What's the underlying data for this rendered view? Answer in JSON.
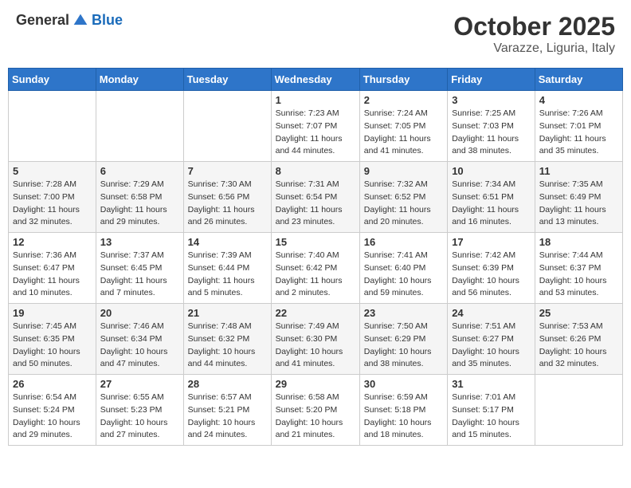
{
  "header": {
    "logo_general": "General",
    "logo_blue": "Blue",
    "month": "October 2025",
    "location": "Varazze, Liguria, Italy"
  },
  "weekdays": [
    "Sunday",
    "Monday",
    "Tuesday",
    "Wednesday",
    "Thursday",
    "Friday",
    "Saturday"
  ],
  "weeks": [
    [
      {
        "day": "",
        "info": ""
      },
      {
        "day": "",
        "info": ""
      },
      {
        "day": "",
        "info": ""
      },
      {
        "day": "1",
        "info": "Sunrise: 7:23 AM\nSunset: 7:07 PM\nDaylight: 11 hours and 44 minutes."
      },
      {
        "day": "2",
        "info": "Sunrise: 7:24 AM\nSunset: 7:05 PM\nDaylight: 11 hours and 41 minutes."
      },
      {
        "day": "3",
        "info": "Sunrise: 7:25 AM\nSunset: 7:03 PM\nDaylight: 11 hours and 38 minutes."
      },
      {
        "day": "4",
        "info": "Sunrise: 7:26 AM\nSunset: 7:01 PM\nDaylight: 11 hours and 35 minutes."
      }
    ],
    [
      {
        "day": "5",
        "info": "Sunrise: 7:28 AM\nSunset: 7:00 PM\nDaylight: 11 hours and 32 minutes."
      },
      {
        "day": "6",
        "info": "Sunrise: 7:29 AM\nSunset: 6:58 PM\nDaylight: 11 hours and 29 minutes."
      },
      {
        "day": "7",
        "info": "Sunrise: 7:30 AM\nSunset: 6:56 PM\nDaylight: 11 hours and 26 minutes."
      },
      {
        "day": "8",
        "info": "Sunrise: 7:31 AM\nSunset: 6:54 PM\nDaylight: 11 hours and 23 minutes."
      },
      {
        "day": "9",
        "info": "Sunrise: 7:32 AM\nSunset: 6:52 PM\nDaylight: 11 hours and 20 minutes."
      },
      {
        "day": "10",
        "info": "Sunrise: 7:34 AM\nSunset: 6:51 PM\nDaylight: 11 hours and 16 minutes."
      },
      {
        "day": "11",
        "info": "Sunrise: 7:35 AM\nSunset: 6:49 PM\nDaylight: 11 hours and 13 minutes."
      }
    ],
    [
      {
        "day": "12",
        "info": "Sunrise: 7:36 AM\nSunset: 6:47 PM\nDaylight: 11 hours and 10 minutes."
      },
      {
        "day": "13",
        "info": "Sunrise: 7:37 AM\nSunset: 6:45 PM\nDaylight: 11 hours and 7 minutes."
      },
      {
        "day": "14",
        "info": "Sunrise: 7:39 AM\nSunset: 6:44 PM\nDaylight: 11 hours and 5 minutes."
      },
      {
        "day": "15",
        "info": "Sunrise: 7:40 AM\nSunset: 6:42 PM\nDaylight: 11 hours and 2 minutes."
      },
      {
        "day": "16",
        "info": "Sunrise: 7:41 AM\nSunset: 6:40 PM\nDaylight: 10 hours and 59 minutes."
      },
      {
        "day": "17",
        "info": "Sunrise: 7:42 AM\nSunset: 6:39 PM\nDaylight: 10 hours and 56 minutes."
      },
      {
        "day": "18",
        "info": "Sunrise: 7:44 AM\nSunset: 6:37 PM\nDaylight: 10 hours and 53 minutes."
      }
    ],
    [
      {
        "day": "19",
        "info": "Sunrise: 7:45 AM\nSunset: 6:35 PM\nDaylight: 10 hours and 50 minutes."
      },
      {
        "day": "20",
        "info": "Sunrise: 7:46 AM\nSunset: 6:34 PM\nDaylight: 10 hours and 47 minutes."
      },
      {
        "day": "21",
        "info": "Sunrise: 7:48 AM\nSunset: 6:32 PM\nDaylight: 10 hours and 44 minutes."
      },
      {
        "day": "22",
        "info": "Sunrise: 7:49 AM\nSunset: 6:30 PM\nDaylight: 10 hours and 41 minutes."
      },
      {
        "day": "23",
        "info": "Sunrise: 7:50 AM\nSunset: 6:29 PM\nDaylight: 10 hours and 38 minutes."
      },
      {
        "day": "24",
        "info": "Sunrise: 7:51 AM\nSunset: 6:27 PM\nDaylight: 10 hours and 35 minutes."
      },
      {
        "day": "25",
        "info": "Sunrise: 7:53 AM\nSunset: 6:26 PM\nDaylight: 10 hours and 32 minutes."
      }
    ],
    [
      {
        "day": "26",
        "info": "Sunrise: 6:54 AM\nSunset: 5:24 PM\nDaylight: 10 hours and 29 minutes."
      },
      {
        "day": "27",
        "info": "Sunrise: 6:55 AM\nSunset: 5:23 PM\nDaylight: 10 hours and 27 minutes."
      },
      {
        "day": "28",
        "info": "Sunrise: 6:57 AM\nSunset: 5:21 PM\nDaylight: 10 hours and 24 minutes."
      },
      {
        "day": "29",
        "info": "Sunrise: 6:58 AM\nSunset: 5:20 PM\nDaylight: 10 hours and 21 minutes."
      },
      {
        "day": "30",
        "info": "Sunrise: 6:59 AM\nSunset: 5:18 PM\nDaylight: 10 hours and 18 minutes."
      },
      {
        "day": "31",
        "info": "Sunrise: 7:01 AM\nSunset: 5:17 PM\nDaylight: 10 hours and 15 minutes."
      },
      {
        "day": "",
        "info": ""
      }
    ]
  ]
}
